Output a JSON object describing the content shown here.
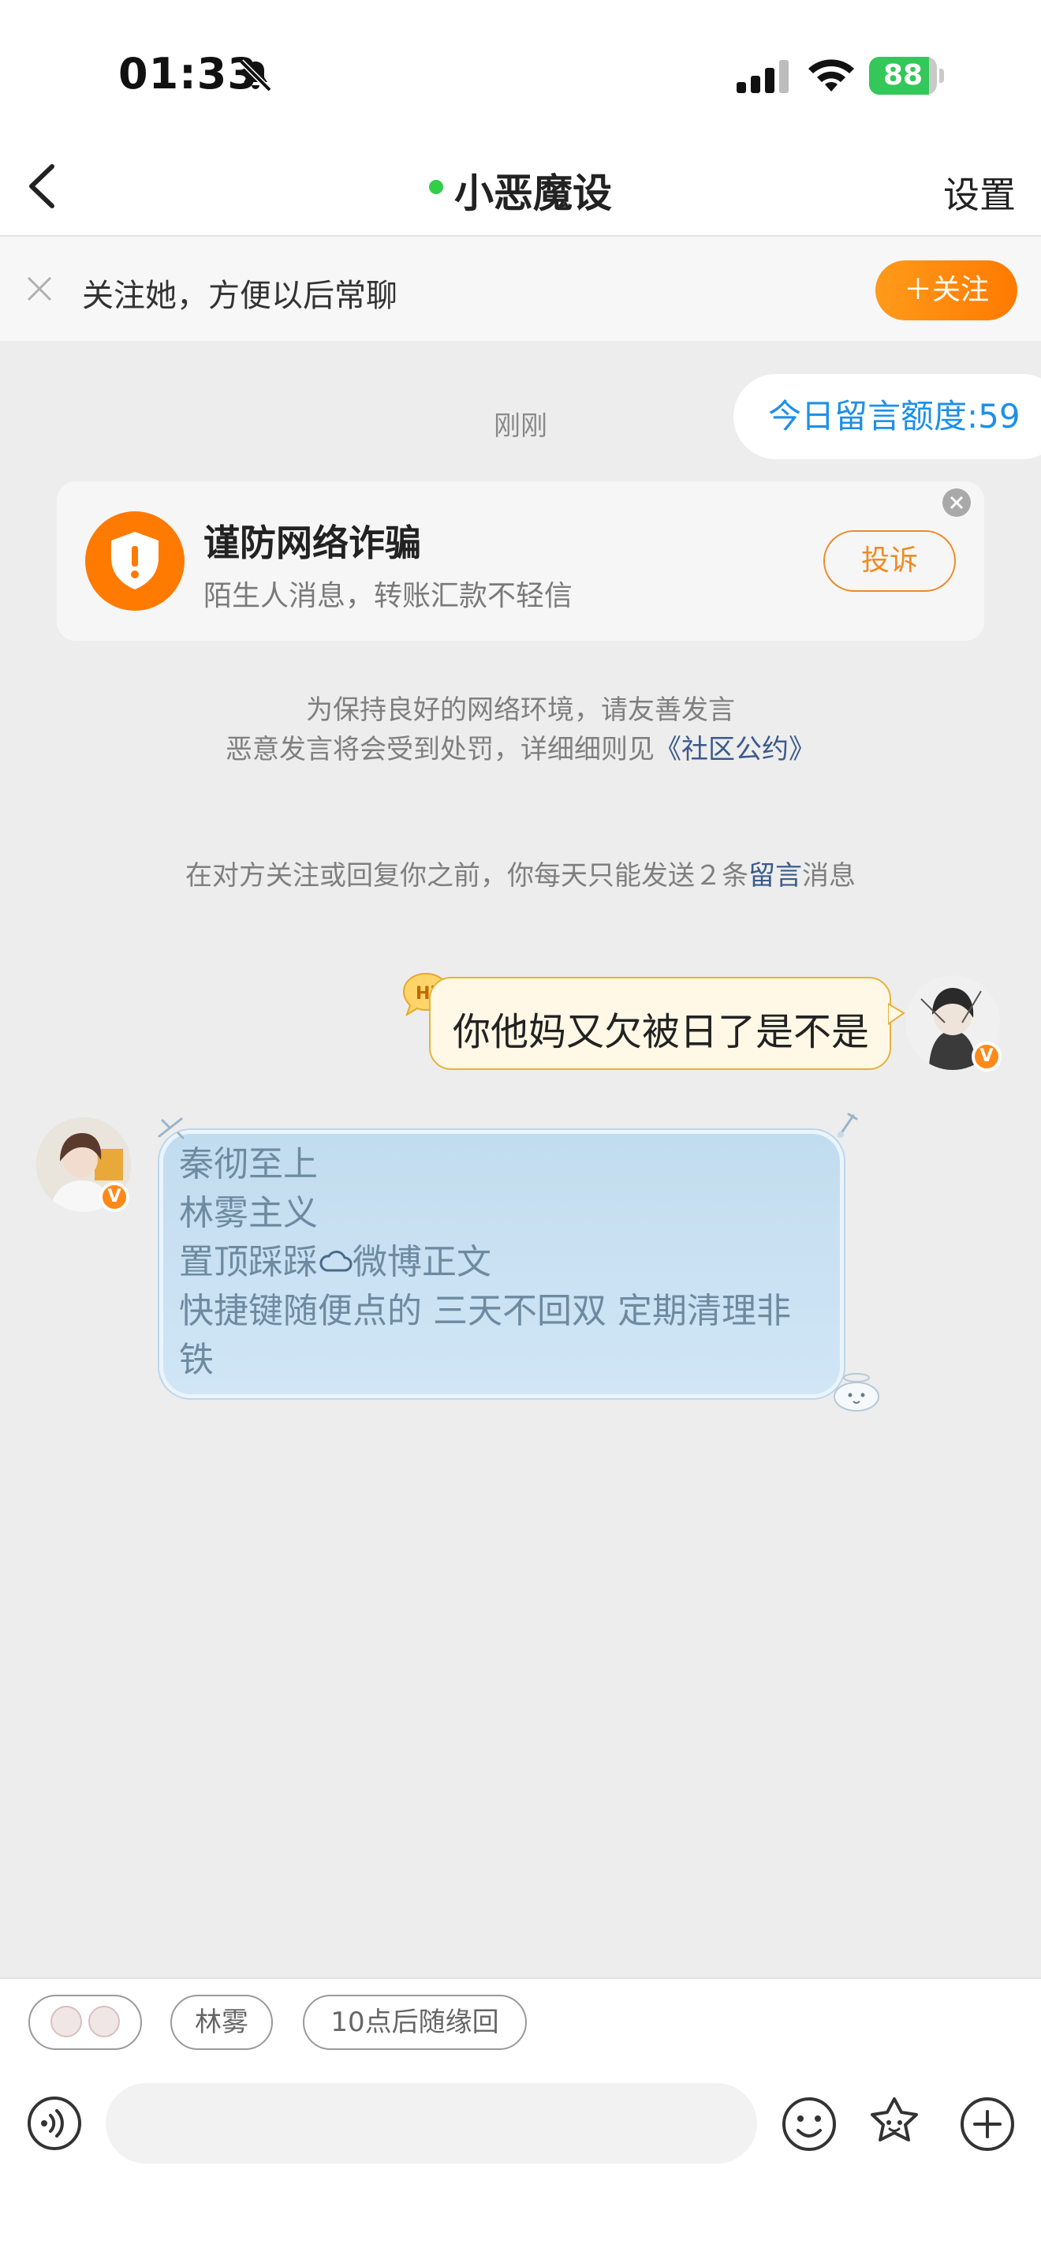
{
  "status_bar": {
    "time": "01:33",
    "battery_level": "88",
    "battery_fraction": 0.88,
    "icons": [
      "bell-slash-icon",
      "signal-icon",
      "wifi-icon",
      "battery-icon"
    ]
  },
  "nav": {
    "title": "小恶魔设",
    "settings": "设置",
    "online_color": "#2fcf4a"
  },
  "follow_bar": {
    "text": "关注她，方便以后常聊",
    "button": "＋关注"
  },
  "chat": {
    "quota": "今日留言额度:59",
    "timestamp": "刚刚",
    "fraud": {
      "title": "谨防网络诈骗",
      "subtitle": "陌生人消息，转账汇款不轻信",
      "report": "投诉"
    },
    "notice_line1": "为保持良好的网络环境，请友善发言",
    "notice_line2_prefix": "恶意发言将会受到处罚，详细细则见",
    "notice_line2_link": "《社区公约》",
    "limit_prefix": "在对方关注或回复你之前，你每天只能发送２条",
    "limit_link": "留言",
    "limit_suffix": "消息",
    "my_message": "你他妈又欠被日了是不是",
    "hi_badge": "Hi",
    "verified_mark": "V",
    "their_lines": [
      "秦彻至上",
      "林雾主义",
      "置顶踩踩",
      "微博正文",
      "快捷键随便点的 三天不回双 定期清理非",
      "铁"
    ]
  },
  "bottom": {
    "quick_replies": [
      "",
      "林雾",
      "10点后随缘回"
    ],
    "input_placeholder": ""
  },
  "colors": {
    "accent_orange": "#ff8a1a",
    "link_blue": "#1e90e8",
    "bubble_blue": "#c8e0f2"
  }
}
